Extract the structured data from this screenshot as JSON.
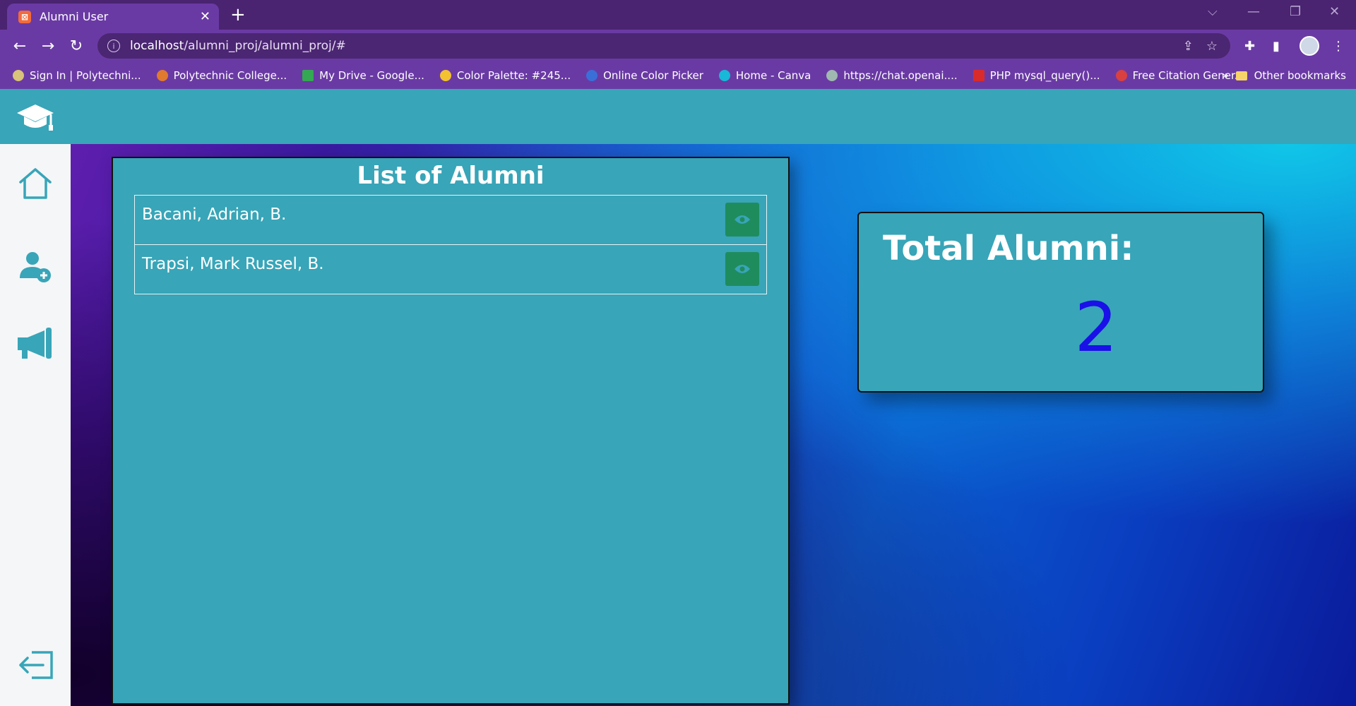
{
  "browser": {
    "tab_title": "Alumni User",
    "tab_close": "✕",
    "new_tab": "+",
    "url_host": "localhost",
    "url_path": "/alumni_proj/alumni_proj/#",
    "bookmarks": [
      {
        "label": "Sign In | Polytechni...",
        "color": "#d9c27a"
      },
      {
        "label": "Polytechnic College...",
        "color": "#e07a2e"
      },
      {
        "label": "My Drive - Google...",
        "color": "#34a853"
      },
      {
        "label": "Color Palette: #245...",
        "color": "#f2c230"
      },
      {
        "label": "Online Color Picker",
        "color": "#3a6fd8"
      },
      {
        "label": "Home - Canva",
        "color": "#18b8d8"
      },
      {
        "label": "https://chat.openai....",
        "color": "#9fb8b0"
      },
      {
        "label": "PHP mysql_query()...",
        "color": "#d92b2b"
      },
      {
        "label": "Free Citation Gener...",
        "color": "#d94040"
      }
    ],
    "bookmarks_more": "»",
    "other_bookmarks": "Other bookmarks"
  },
  "app": {
    "accent_color": "#38a5b8",
    "view_button_color": "#1f8c5e",
    "sidebar_icons": [
      "home-icon",
      "add-user-icon",
      "megaphone-icon",
      "logout-icon"
    ]
  },
  "list": {
    "title": "List of Alumni",
    "rows": [
      {
        "name": "Bacani, Adrian, B."
      },
      {
        "name": "Trapsi, Mark Russel, B."
      }
    ]
  },
  "summary": {
    "label": "Total Alumni:",
    "value": "2"
  }
}
